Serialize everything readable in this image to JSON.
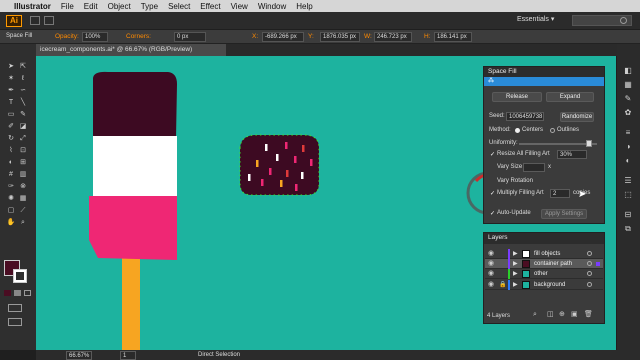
{
  "menubar": {
    "app": "Illustrator",
    "items": [
      "File",
      "Edit",
      "Object",
      "Type",
      "Select",
      "Effect",
      "View",
      "Window",
      "Help"
    ]
  },
  "appbar": {
    "logo": "Ai",
    "workspace": "Essentials ▾"
  },
  "control": {
    "selection_label": "Space Fill",
    "opacity_label": "Opacity:",
    "opacity_value": "100%",
    "corners_label": "Corners:",
    "corners_value": "0 px",
    "x_label": "X:",
    "x_value": "-689.266 px",
    "y_label": "Y:",
    "y_value": "1876.035 px",
    "w_label": "W:",
    "w_value": "246.723 px",
    "h_label": "H:",
    "h_value": "186.141 px"
  },
  "document": {
    "tab": "icecream_components.ai* @ 66.67% (RGB/Preview)"
  },
  "space_fill_panel": {
    "title": "Space Fill",
    "release_label": "Release",
    "expand_label": "Expand",
    "seed_label": "Seed:",
    "seed_value": "1006459738",
    "randomize_label": "Randomize",
    "method_label": "Method:",
    "method_options": [
      "Centers",
      "Outlines"
    ],
    "uniformity_label": "Uniformity:",
    "uniformity_value": 0.9,
    "resize_label": "Resize All Filling Art",
    "resize_value": "30%",
    "vary_size_label": "Vary Size",
    "vary_size_unit": "x",
    "vary_rotation_label": "Vary Rotation",
    "multiply_label": "Multiply Filling Art",
    "multiply_value": "2",
    "multiply_unit": "copies",
    "auto_update_label": "Auto-Update",
    "apply_label": "Apply Settings"
  },
  "layers_panel": {
    "title": "Layers",
    "layers": [
      {
        "name": "fill objects",
        "swatch": "#ffffff",
        "color": "#7a3cff",
        "selected": false,
        "locked": false
      },
      {
        "name": "container path",
        "swatch": "#4a0d22",
        "color": "#7a3cff",
        "selected": true,
        "locked": false
      },
      {
        "name": "other",
        "swatch": "#1db39f",
        "color": "#2ad12a",
        "selected": false,
        "locked": false
      },
      {
        "name": "background",
        "swatch": "#1db39f",
        "color": "#2a7bff",
        "selected": false,
        "locked": true
      }
    ],
    "count": "4 Layers"
  },
  "statusbar": {
    "zoom": "66.67%",
    "page": "1",
    "tool": "Direct Selection"
  },
  "colors": {
    "canvas": "#1db39f",
    "chocolate": "#3d0a22",
    "white_band": "#ffffff",
    "pink": "#ef2774",
    "stick": "#f7a521",
    "panel_accent": "#2a8bd8",
    "accent": "#ff8a00"
  },
  "icons": [
    "apple-icon",
    "search-icon",
    "selection-tool-icon",
    "pen-tool-icon",
    "type-tool-icon",
    "layers-icon",
    "eye-icon",
    "lock-icon",
    "new-layer-icon",
    "trash-icon",
    "cursor-icon"
  ]
}
